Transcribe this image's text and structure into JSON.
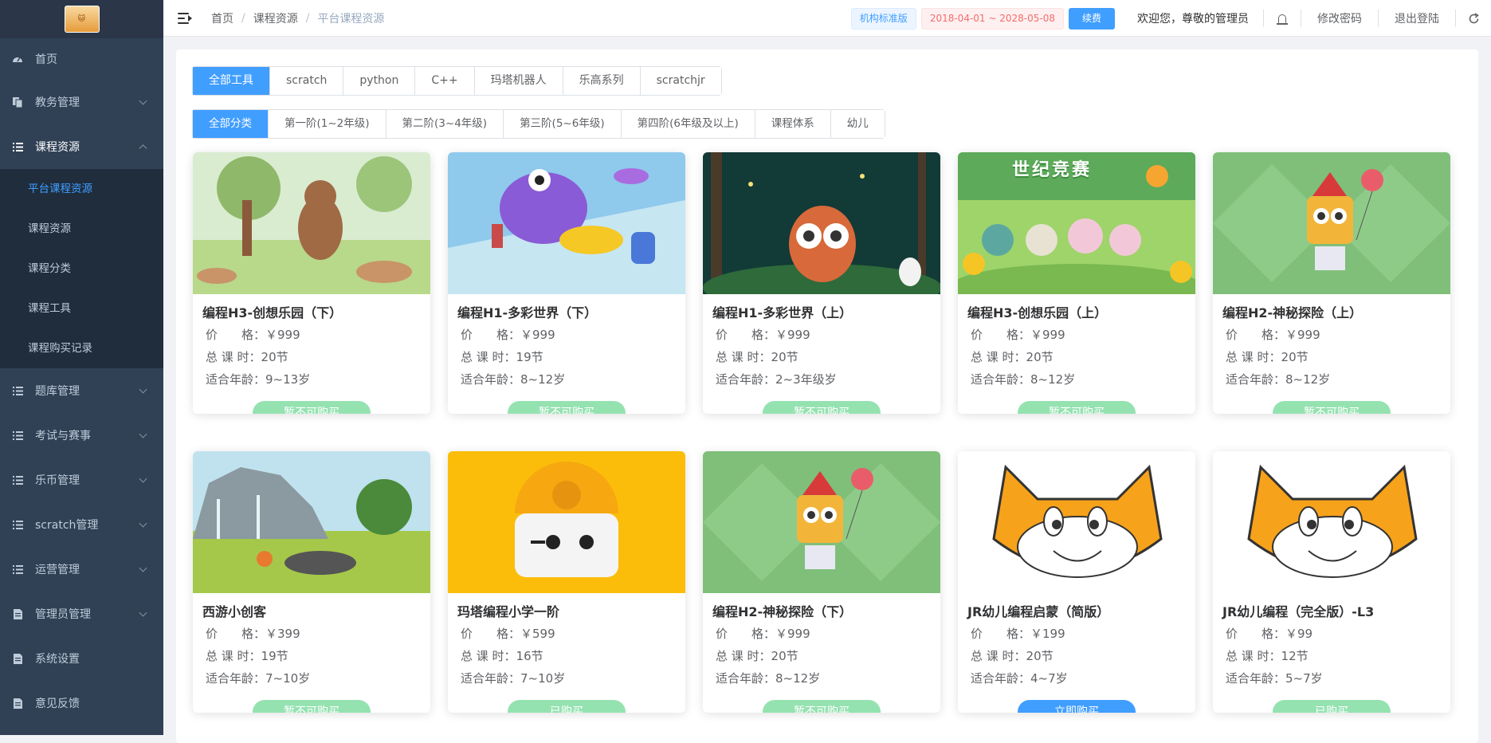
{
  "sidebar": {
    "logo_alt": "logo",
    "items": [
      {
        "label": "首页",
        "icon": "dashboard-icon"
      },
      {
        "label": "教务管理",
        "icon": "copy-icon"
      },
      {
        "label": "课程资源",
        "icon": "list-icon"
      },
      {
        "label": "题库管理",
        "icon": "list-icon"
      },
      {
        "label": "考试与赛事",
        "icon": "list-icon"
      },
      {
        "label": "乐币管理",
        "icon": "list-icon"
      },
      {
        "label": "scratch管理",
        "icon": "list-icon"
      },
      {
        "label": "运营管理",
        "icon": "list-icon"
      },
      {
        "label": "管理员管理",
        "icon": "document-icon"
      },
      {
        "label": "系统设置",
        "icon": "document-icon"
      },
      {
        "label": "意见反馈",
        "icon": "document-icon"
      }
    ],
    "sub_items": [
      {
        "label": "平台课程资源"
      },
      {
        "label": "课程资源"
      },
      {
        "label": "课程分类"
      },
      {
        "label": "课程工具"
      },
      {
        "label": "课程购买记录"
      }
    ]
  },
  "header": {
    "breadcrumb": [
      "首页",
      "课程资源",
      "平台课程资源"
    ],
    "edition": "机构标准版",
    "validity": "2018-04-01 ~ 2028-05-08",
    "renew": "续费",
    "welcome": "欢迎您，尊敬的管理员",
    "change_password": "修改密码",
    "logout": "退出登陆"
  },
  "tool_tabs": [
    "全部工具",
    "scratch",
    "python",
    "C++",
    "玛塔机器人",
    "乐高系列",
    "scratchjr"
  ],
  "category_tabs": [
    "全部分类",
    "第一阶(1~2年级)",
    "第二阶(3~4年级)",
    "第三阶(5~6年级)",
    "第四阶(6年级及以上)",
    "课程体系",
    "幼儿"
  ],
  "labels": {
    "price": "价　　格：",
    "hours": "总 课 时：",
    "age": "适合年龄："
  },
  "colors": {
    "accent": "#409eff",
    "disabled_button": "#95e2b1",
    "sidebar": "#304156"
  },
  "courses": [
    {
      "title": "编程H3-创想乐园（下）",
      "price": "￥999",
      "hours": "20节",
      "age": "9~13岁",
      "button": "暂不可购买",
      "status": "disabled"
    },
    {
      "title": "编程H1-多彩世界（下）",
      "price": "￥999",
      "hours": "19节",
      "age": "8~12岁",
      "button": "暂不可购买",
      "status": "disabled"
    },
    {
      "title": "编程H1-多彩世界（上）",
      "price": "￥999",
      "hours": "20节",
      "age": "2~3年级岁",
      "button": "暂不可购买",
      "status": "disabled"
    },
    {
      "title": "编程H3-创想乐园（上）",
      "price": "￥999",
      "hours": "20节",
      "age": "8~12岁",
      "button": "暂不可购买",
      "status": "disabled",
      "overlay": "世纪竞赛"
    },
    {
      "title": "编程H2-神秘探险（上）",
      "price": "￥999",
      "hours": "20节",
      "age": "8~12岁",
      "button": "暂不可购买",
      "status": "disabled"
    },
    {
      "title": "西游小创客",
      "price": "￥399",
      "hours": "19节",
      "age": "7~10岁",
      "button": "暂不可购买",
      "status": "disabled"
    },
    {
      "title": "玛塔编程小学一阶",
      "price": "￥599",
      "hours": "16节",
      "age": "7~10岁",
      "button": "已购买",
      "status": "bought"
    },
    {
      "title": "编程H2-神秘探险（下）",
      "price": "￥999",
      "hours": "20节",
      "age": "8~12岁",
      "button": "暂不可购买",
      "status": "disabled"
    },
    {
      "title": "JR幼儿编程启蒙（简版）",
      "price": "￥199",
      "hours": "20节",
      "age": "4~7岁",
      "button": "立即购买",
      "status": "available"
    },
    {
      "title": "JR幼儿编程（完全版）-L3",
      "price": "￥99",
      "hours": "12节",
      "age": "5~7岁",
      "button": "已购买",
      "status": "bought"
    }
  ]
}
